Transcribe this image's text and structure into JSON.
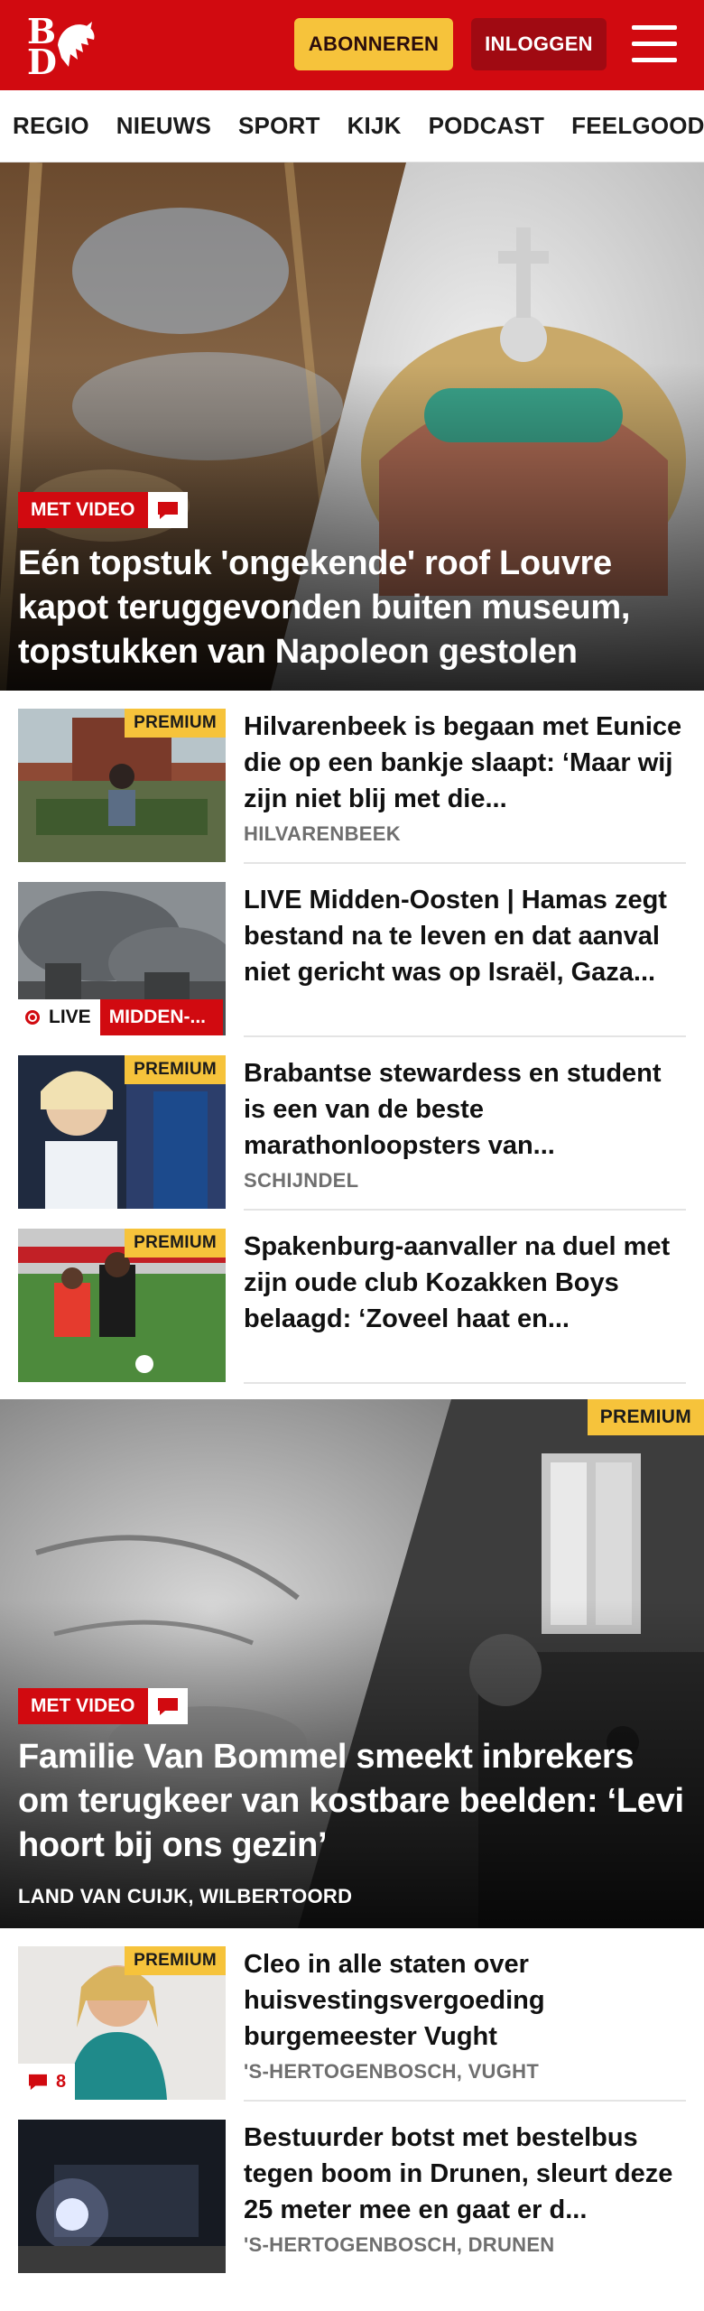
{
  "header": {
    "logo_text": "BD",
    "subscribe_label": "ABONNEREN",
    "login_label": "INLOGGEN",
    "menu_icon": "hamburger-menu-icon",
    "brand_color": "#d10a10",
    "accent_color": "#f6c33b"
  },
  "nav": {
    "items": [
      "REGIO",
      "NIEUWS",
      "SPORT",
      "KIJK",
      "PODCAST",
      "FEELGOOD"
    ]
  },
  "hero1": {
    "badge": "MET VIDEO",
    "badge_icon": "comment-icon",
    "title": "Eén topstuk 'ongekende' roof Louvre kapot teruggevonden buiten museum, topstukken van Napoleon gestolen"
  },
  "articles": [
    {
      "premium": "PREMIUM",
      "title": "Hilvarenbeek is begaan met Eunice die op een bankje slaapt: ‘Maar wij zijn niet blij met die...",
      "location": "HILVARENBEEK"
    },
    {
      "live_label": "LIVE",
      "category": "MIDDEN-...",
      "title": "LIVE Midden-Oosten | Hamas zegt bestand na te leven en dat aanval niet gericht was op Israël, Gaza..."
    },
    {
      "premium": "PREMIUM",
      "title": "Brabantse stewardess en student is een van de beste marathonloopsters van...",
      "location": "SCHIJNDEL"
    },
    {
      "premium": "PREMIUM",
      "title": "Spakenburg-aanvaller na duel met zijn oude club Kozakken Boys belaagd: ‘Zoveel haat en..."
    }
  ],
  "hero2": {
    "premium": "PREMIUM",
    "badge": "MET VIDEO",
    "badge_icon": "comment-icon",
    "title": "Familie Van Bommel smeekt inbrekers om terugkeer van kostbare beelden: ‘Levi hoort bij ons gezin’",
    "location": "LAND VAN CUIJK, WILBERTOORD"
  },
  "articles2": [
    {
      "premium": "PREMIUM",
      "comments": "8",
      "title": "Cleo in alle staten over huisvestingsvergoeding burgemeester Vught",
      "location": "'S-HERTOGENBOSCH, VUGHT"
    },
    {
      "title": "Bestuurder botst met bestelbus tegen boom in Drunen, sleurt deze 25 meter mee en gaat er d...",
      "location": "'S-HERTOGENBOSCH, DRUNEN"
    }
  ]
}
